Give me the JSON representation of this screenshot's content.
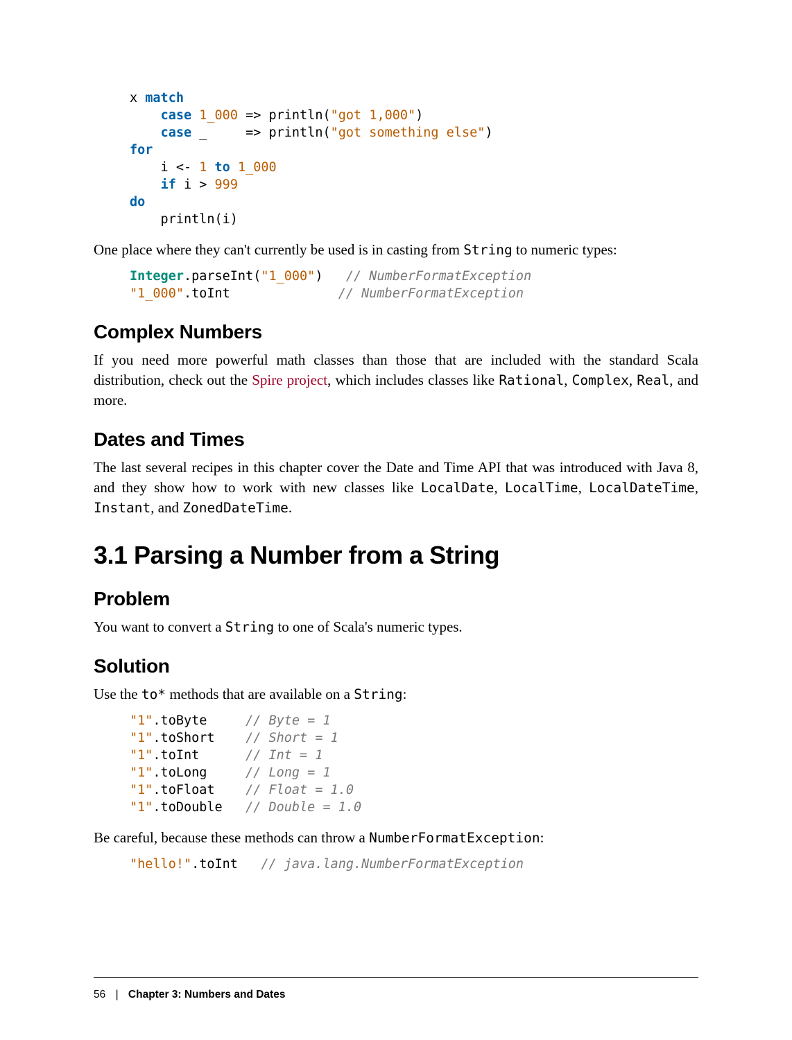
{
  "code1": {
    "l1a": "x ",
    "l1b": "match",
    "l2a": "    ",
    "l2b": "case",
    "l2c": " ",
    "l2d": "1_000",
    "l2e": " => println(",
    "l2f": "\"got 1,000\"",
    "l2g": ")",
    "l3a": "    ",
    "l3b": "case",
    "l3c": " _     => println(",
    "l3d": "\"got something else\"",
    "l3e": ")",
    "l4": "for",
    "l5a": "    i <- ",
    "l5b": "1",
    "l5c": " ",
    "l5d": "to",
    "l5e": " ",
    "l5f": "1_000",
    "l6a": "    ",
    "l6b": "if",
    "l6c": " i > ",
    "l6d": "999",
    "l7": "do",
    "l8": "    println(i)"
  },
  "para1": {
    "t1": "One place where they can't currently be used is in casting from ",
    "c1": "String",
    "t2": " to numeric types:"
  },
  "code2": {
    "l1a": "Integer",
    "l1b": ".parseInt(",
    "l1c": "\"1_000\"",
    "l1d": ")   ",
    "l1e": "// NumberFormatException",
    "l2a": "\"1_000\"",
    "l2b": ".toInt              ",
    "l2c": "// NumberFormatException"
  },
  "h_complex": "Complex Numbers",
  "para2": {
    "t1": "If you need more powerful math classes than those that are included with the stan­dard Scala distribution, check out the ",
    "link": "Spire project",
    "t2": ", which includes classes like ",
    "c1": "Rational",
    "t3": ", ",
    "c2": "Complex",
    "t4": ", ",
    "c3": "Real",
    "t5": ", and more."
  },
  "h_dates": "Dates and Times",
  "para3": {
    "t1": "The last several recipes in this chapter cover the Date and Time API that was intro­duced with Java 8, and they show how to work with new classes like ",
    "c1": "LocalDate",
    "t2": ", ",
    "c2": "LocalTime",
    "t3": ", ",
    "c3": "LocalDateTime",
    "t4": ", ",
    "c4": "Instant",
    "t5": ", and ",
    "c5": "ZonedDateTime",
    "t6": "."
  },
  "h_31": "3.1 Parsing a Number from a String",
  "h_problem": "Problem",
  "para4": {
    "t1": "You want to convert a ",
    "c1": "String",
    "t2": " to one of Scala's numeric types."
  },
  "h_solution": "Solution",
  "para5": {
    "t1": "Use the ",
    "c1": "to*",
    "t2": " methods that are available on a ",
    "c2": "String",
    "t3": ":"
  },
  "code3": {
    "l1a": "\"1\"",
    "l1b": ".toByte     ",
    "l1c": "// Byte = 1",
    "l2a": "\"1\"",
    "l2b": ".toShort    ",
    "l2c": "// Short = 1",
    "l3a": "\"1\"",
    "l3b": ".toInt      ",
    "l3c": "// Int = 1",
    "l4a": "\"1\"",
    "l4b": ".toLong     ",
    "l4c": "// Long = 1",
    "l5a": "\"1\"",
    "l5b": ".toFloat    ",
    "l5c": "// Float = 1.0",
    "l6a": "\"1\"",
    "l6b": ".toDouble   ",
    "l6c": "// Double = 1.0"
  },
  "para6": {
    "t1": "Be careful, because these methods can throw a ",
    "c1": "NumberFormatException",
    "t2": ":"
  },
  "code4": {
    "l1a": "\"hello!\"",
    "l1b": ".toInt   ",
    "l1c": "// java.lang.NumberFormatException"
  },
  "footer": {
    "page": "56",
    "sep": "|",
    "chapter": "Chapter 3: Numbers and Dates"
  }
}
